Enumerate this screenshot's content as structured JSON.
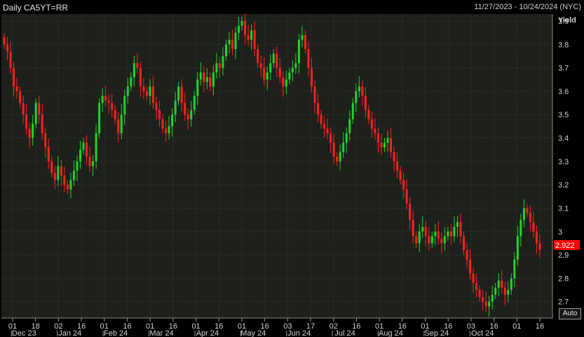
{
  "header": {
    "title": "Daily CA5YT=RR",
    "date_range": "11/27/2023 - 10/24/2024 (NYC)"
  },
  "controls": {
    "auto_label": "Auto"
  },
  "colors": {
    "up": "#21d42a",
    "down": "#ff2020",
    "plot_bg": "#1e201c",
    "last_bg": "#ff0000"
  },
  "chart_data": {
    "type": "candlestick",
    "title": "Daily CA5YT=RR",
    "ylabel": "Yield",
    "ylim": [
      2.63,
      3.93
    ],
    "yticks": [
      2.7,
      2.8,
      2.9,
      3,
      3.1,
      3.2,
      3.3,
      3.4,
      3.5,
      3.6,
      3.7,
      3.8,
      3.9
    ],
    "ytick_labels": [
      "2.7",
      "2.8",
      "2.9",
      "3",
      "3.1",
      "3.2",
      "3.3",
      "3.4",
      "3.5",
      "3.6",
      "3.7",
      "3.8",
      "3.9"
    ],
    "last_value": "2.922",
    "xticks_day": [
      "01",
      "18",
      "02",
      "16",
      "01",
      "16",
      "01",
      "16",
      "01",
      "16",
      "01",
      "16",
      "03",
      "17",
      "02",
      "16",
      "01",
      "16",
      "01",
      "16",
      "03",
      "16",
      "01",
      "16"
    ],
    "xticks_month": [
      "Dec 23",
      "Jan 24",
      "Feb 24",
      "Mar 24",
      "Apr 24",
      "May 24",
      "Jun 24",
      "Jul 24",
      "Aug 24",
      "Sep 24",
      "Oct 24"
    ],
    "x_start": "2023-11-27",
    "x_end": "2024-10-24",
    "close_series": [
      3.8,
      3.77,
      3.7,
      3.62,
      3.6,
      3.55,
      3.5,
      3.44,
      3.4,
      3.46,
      3.55,
      3.5,
      3.42,
      3.36,
      3.3,
      3.25,
      3.22,
      3.28,
      3.24,
      3.2,
      3.18,
      3.22,
      3.26,
      3.3,
      3.35,
      3.38,
      3.32,
      3.28,
      3.3,
      3.42,
      3.55,
      3.58,
      3.56,
      3.55,
      3.52,
      3.48,
      3.42,
      3.5,
      3.58,
      3.62,
      3.66,
      3.72,
      3.7,
      3.62,
      3.6,
      3.58,
      3.62,
      3.55,
      3.52,
      3.48,
      3.44,
      3.42,
      3.45,
      3.5,
      3.56,
      3.62,
      3.55,
      3.5,
      3.48,
      3.52,
      3.58,
      3.65,
      3.68,
      3.64,
      3.66,
      3.62,
      3.68,
      3.72,
      3.7,
      3.75,
      3.8,
      3.82,
      3.78,
      3.85,
      3.88,
      3.9,
      3.84,
      3.82,
      3.86,
      3.78,
      3.72,
      3.7,
      3.65,
      3.68,
      3.72,
      3.76,
      3.7,
      3.66,
      3.62,
      3.65,
      3.68,
      3.7,
      3.72,
      3.82,
      3.84,
      3.78,
      3.7,
      3.62,
      3.55,
      3.5,
      3.46,
      3.44,
      3.42,
      3.38,
      3.32,
      3.3,
      3.34,
      3.38,
      3.42,
      3.48,
      3.55,
      3.6,
      3.62,
      3.58,
      3.52,
      3.48,
      3.44,
      3.42,
      3.38,
      3.36,
      3.38,
      3.4,
      3.34,
      3.3,
      3.26,
      3.22,
      3.18,
      3.12,
      3.05,
      2.98,
      2.95,
      3.0,
      3.02,
      2.98,
      2.95,
      2.98,
      3.0,
      2.97,
      2.95,
      2.98,
      3.0,
      2.98,
      3.02,
      3.04,
      2.98,
      2.92,
      2.88,
      2.82,
      2.78,
      2.75,
      2.72,
      2.7,
      2.68,
      2.7,
      2.73,
      2.76,
      2.79,
      2.76,
      2.73,
      2.75,
      2.8,
      2.88,
      2.98,
      3.05,
      3.1,
      3.08,
      3.04,
      3.0,
      2.95,
      2.922
    ]
  }
}
